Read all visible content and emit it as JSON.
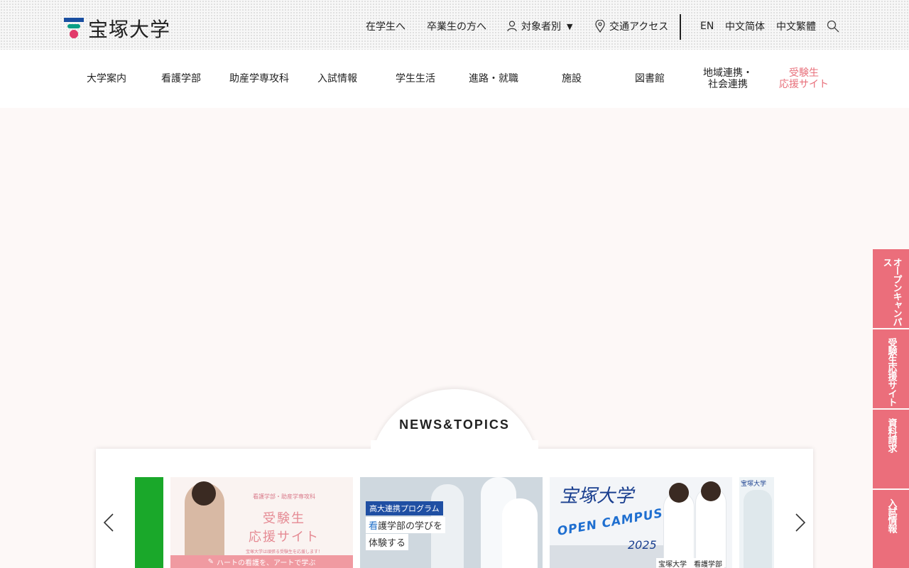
{
  "header": {
    "logo_text": "宝塚大学",
    "utility_links": [
      {
        "label": "在学生へ"
      },
      {
        "label": "卒業生の方へ"
      },
      {
        "label": "対象者別",
        "caret": "▼"
      },
      {
        "label": "交通アクセス"
      }
    ],
    "languages": [
      "EN",
      "中文简体",
      "中文繁體"
    ],
    "icons": {
      "person": "person-icon",
      "location": "map-pin-icon",
      "search": "search-icon"
    }
  },
  "nav": {
    "items": [
      {
        "label": "大学案内"
      },
      {
        "label": "看護学部"
      },
      {
        "label": "助産学専攻科"
      },
      {
        "label": "入試情報"
      },
      {
        "label": "学生生活"
      },
      {
        "label": "進路・就職"
      },
      {
        "label": "施設"
      },
      {
        "label": "図書館"
      },
      {
        "label_line1": "地域連携・",
        "label_line2": "社会連携"
      },
      {
        "label_line1": "受験生",
        "label_line2": "応援サイト"
      }
    ]
  },
  "news": {
    "title": "NEWS&TOPICS",
    "prev_arrow": "‹",
    "next_arrow": "›",
    "cards": [
      {
        "subtitle": "看護学部・助産学専攻科",
        "title_line1": "受験生",
        "title_line2": "応援サイト",
        "note": "宝塚大学は頑張る受験生を応援します！",
        "band": "ハートの看護を、アートで学ぶ"
      },
      {
        "tag": "高大連携プログラム",
        "line1_hl": "看",
        "line1_rest": "護学部の学びを",
        "line2": "体験する"
      },
      {
        "script": "宝塚大学",
        "headline": "OPEN CAMPUS",
        "year": "2025",
        "footer": "宝塚大学　看護学部"
      },
      {
        "logo": "宝塚大学"
      }
    ]
  },
  "side_tabs": [
    {
      "label": "オープンキャンパス"
    },
    {
      "label": "受験生応援サイト"
    },
    {
      "label": "資料請求"
    },
    {
      "label": "入試情報"
    }
  ],
  "colors": {
    "accent_pink": "#eb6e7b",
    "nav_pink": "#e8707b",
    "logo_blue": "#1a4fa0",
    "logo_green": "#0a9e86",
    "logo_red": "#e23a6a"
  }
}
